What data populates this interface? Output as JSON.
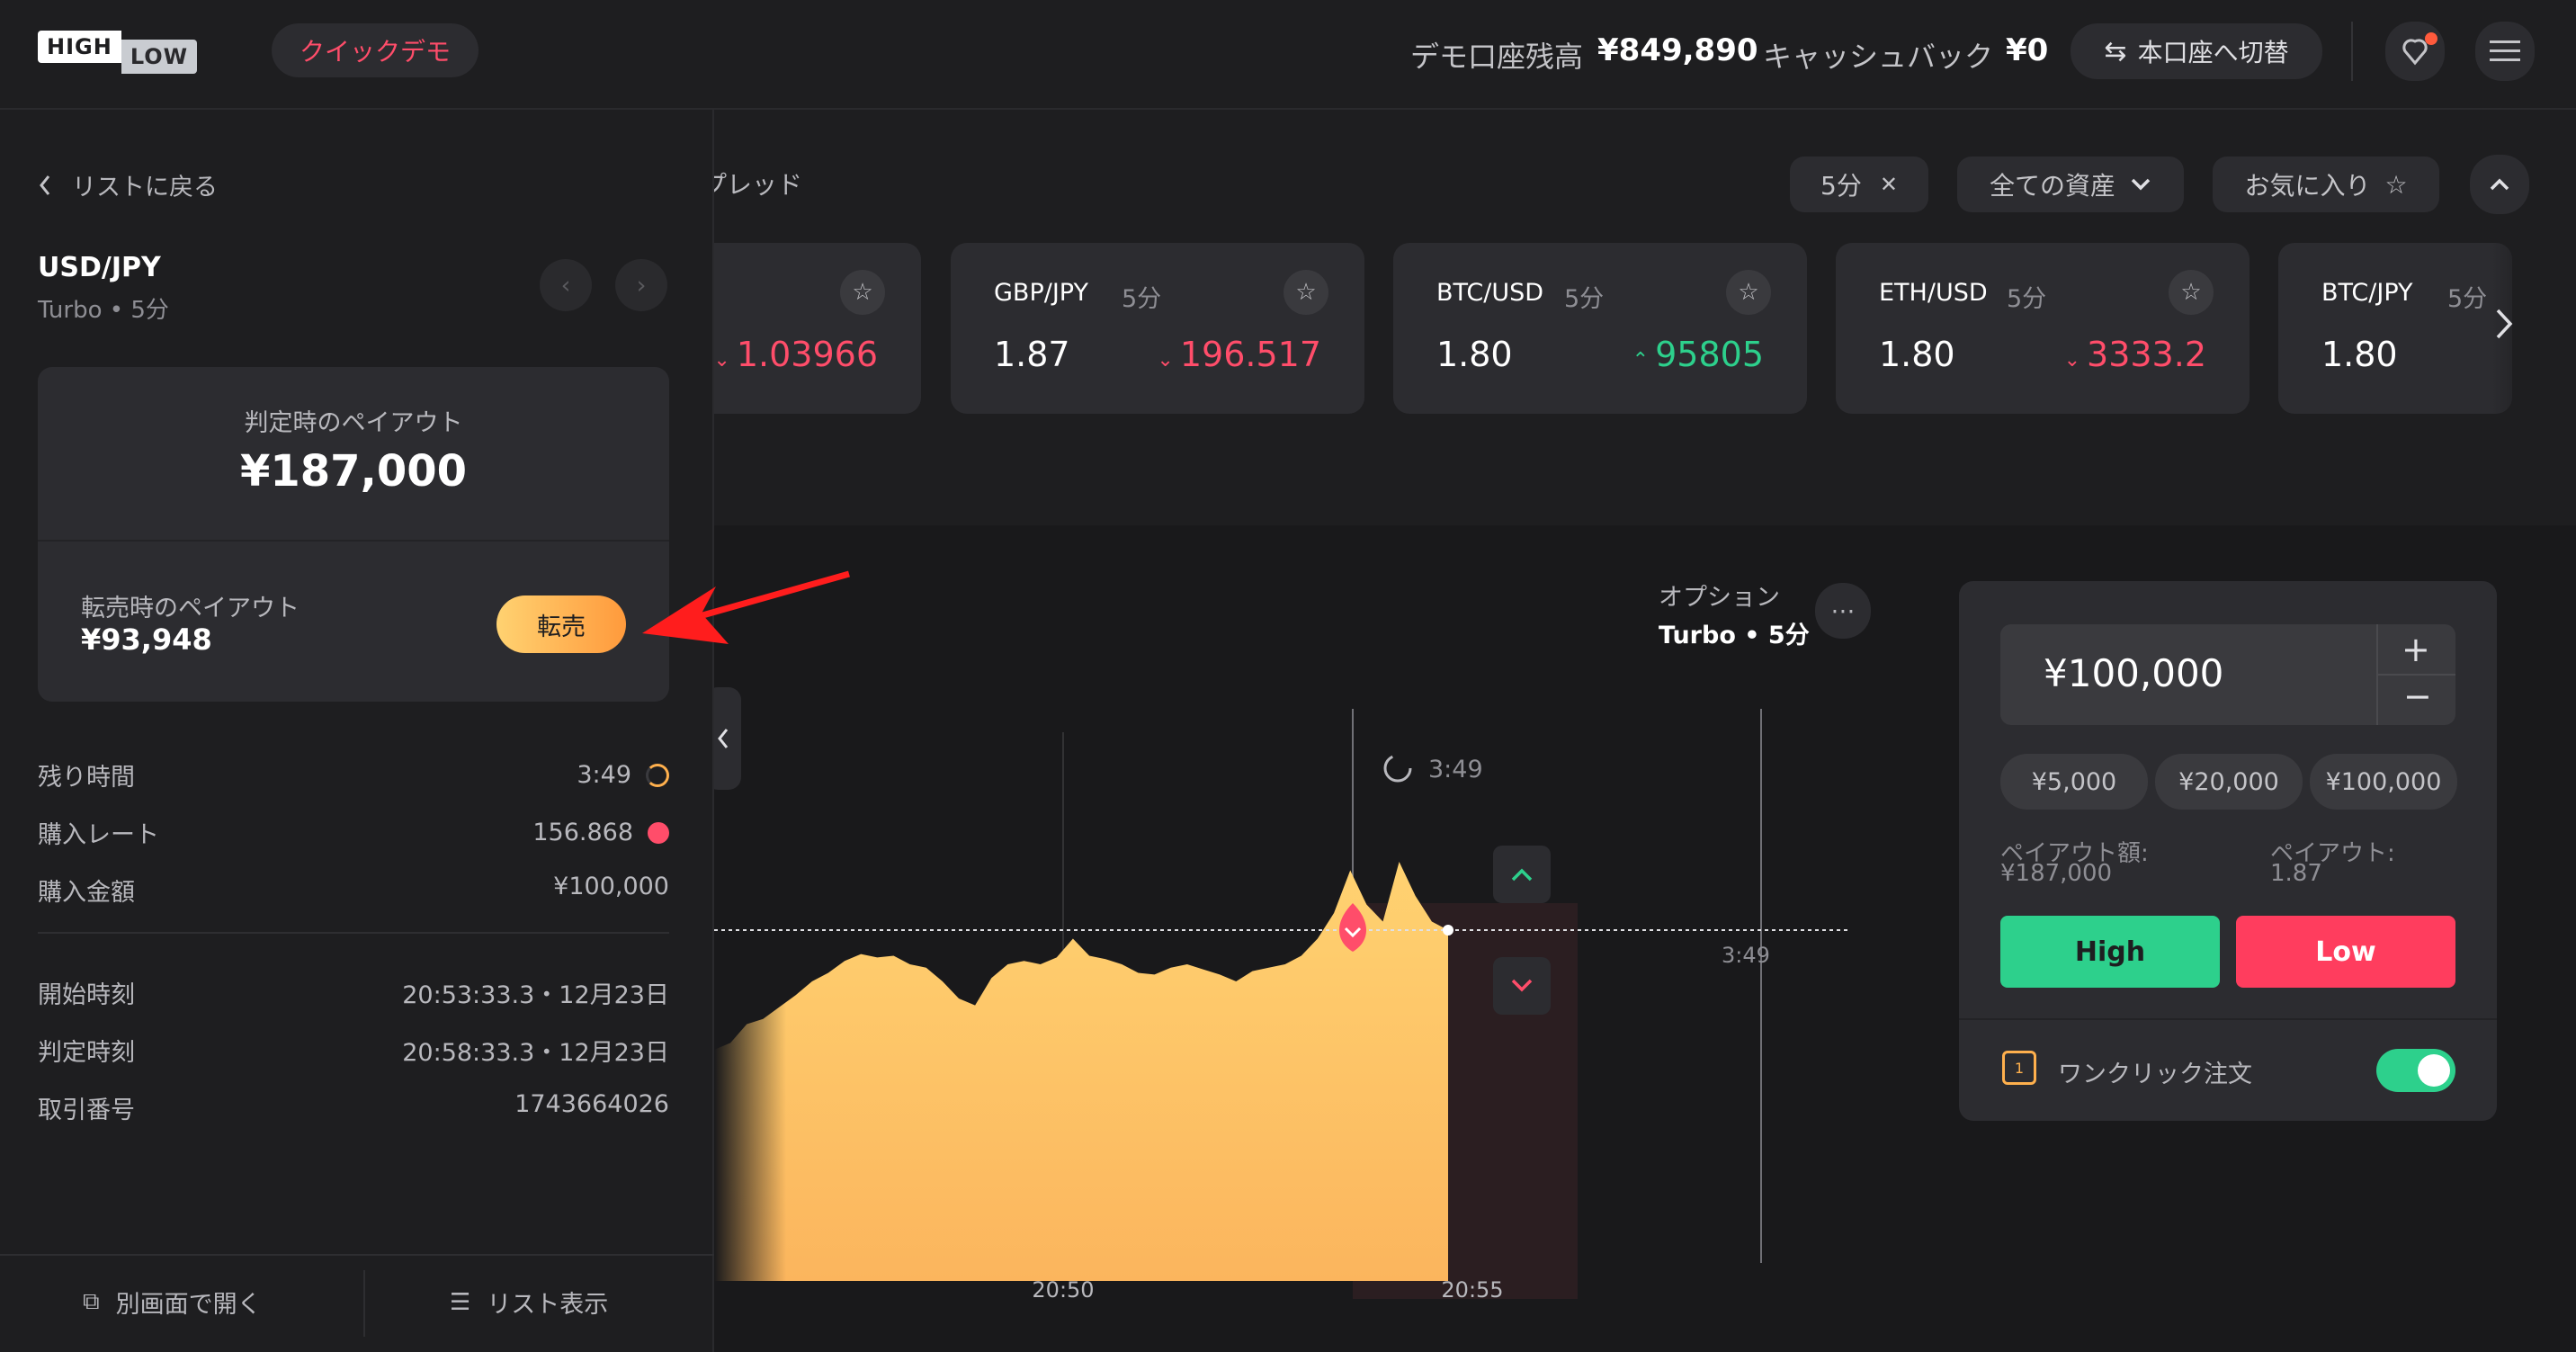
{
  "header": {
    "logo_top": "HIGH",
    "logo_bottom": "LOW",
    "demo_badge": "クイックデモ",
    "balance_label": "デモ口座残高",
    "balance_value": "¥849,890",
    "cashback_label": "キャッシュバック",
    "cashback_value": "¥0",
    "switch_label": "本口座へ切替"
  },
  "filters": {
    "section_title": "プレッド",
    "duration_chip": "5分",
    "assets_dropdown": "全ての資産",
    "favorites": "お気に入り"
  },
  "cards": [
    {
      "name": "",
      "period": "",
      "payout": "",
      "rate": "1.03966",
      "dir": "down"
    },
    {
      "name": "GBP/JPY",
      "period": "5分",
      "payout": "1.87",
      "rate": "196.517",
      "dir": "down"
    },
    {
      "name": "BTC/USD",
      "period": "5分",
      "payout": "1.80",
      "rate": "95805",
      "dir": "up"
    },
    {
      "name": "ETH/USD",
      "period": "5分",
      "payout": "1.80",
      "rate": "3333.2",
      "dir": "down"
    },
    {
      "name": "BTC/JPY",
      "period": "5分",
      "payout": "1.80",
      "rate": "",
      "dir": "down"
    }
  ],
  "left": {
    "back": "リストに戻る",
    "pair": "USD/JPY",
    "sub": "Turbo • 5分",
    "payout_at_expiry_label": "判定時のペイアウト",
    "payout_at_expiry_value": "¥187,000",
    "resale_label": "転売時のペイアウト",
    "resale_value": "¥93,948",
    "resale_button": "転売",
    "details": [
      {
        "label": "残り時間",
        "value": "3:49"
      },
      {
        "label": "購入レート",
        "value": "156.868"
      },
      {
        "label": "購入金額",
        "value": "¥100,000"
      }
    ],
    "times": [
      {
        "label": "開始時刻",
        "value": "20:53:33.3・12月23日"
      },
      {
        "label": "判定時刻",
        "value": "20:58:33.3・12月23日"
      },
      {
        "label": "取引番号",
        "value": "1743664026"
      }
    ],
    "open_new": "別画面で開く",
    "list_view": "リスト表示"
  },
  "chart": {
    "option_label": "オプション",
    "option_sub": "Turbo • 5分",
    "countdown": "3:49",
    "time_ticks": [
      "20:50",
      "20:55"
    ]
  },
  "chart_data": {
    "type": "area",
    "x_ticks": [
      "20:50",
      "20:55"
    ],
    "entry_rate": 156.868,
    "series": [
      {
        "values": [
          0.3,
          0.34,
          0.45,
          0.48,
          0.55,
          0.62,
          0.7,
          0.75,
          0.82,
          0.86,
          0.84,
          0.85,
          0.8,
          0.78,
          0.7,
          0.6,
          0.56,
          0.72,
          0.8,
          0.82,
          0.8,
          0.84,
          0.95,
          0.85,
          0.83,
          0.8,
          0.75,
          0.74,
          0.78,
          0.8,
          0.77,
          0.74,
          0.7,
          0.76,
          0.78,
          0.8,
          0.85,
          0.95,
          1.1,
          1.35,
          1.15,
          1.05,
          1.4,
          1.2,
          1.05,
          1.0
        ]
      }
    ]
  },
  "trade": {
    "amount": "¥100,000",
    "presets": [
      "¥5,000",
      "¥20,000",
      "¥100,000"
    ],
    "payout_amount_label": "ペイアウト額:",
    "payout_amount_value": "¥187,000",
    "payout_label": "ペイアウト:",
    "payout_value": "1.87",
    "high": "High",
    "low": "Low",
    "one_click": "ワンクリック注文"
  },
  "colors": {
    "accent": "#ff4d6a",
    "high": "#2dd08c",
    "low": "#ff3d5e",
    "area": "#ffc56a"
  }
}
